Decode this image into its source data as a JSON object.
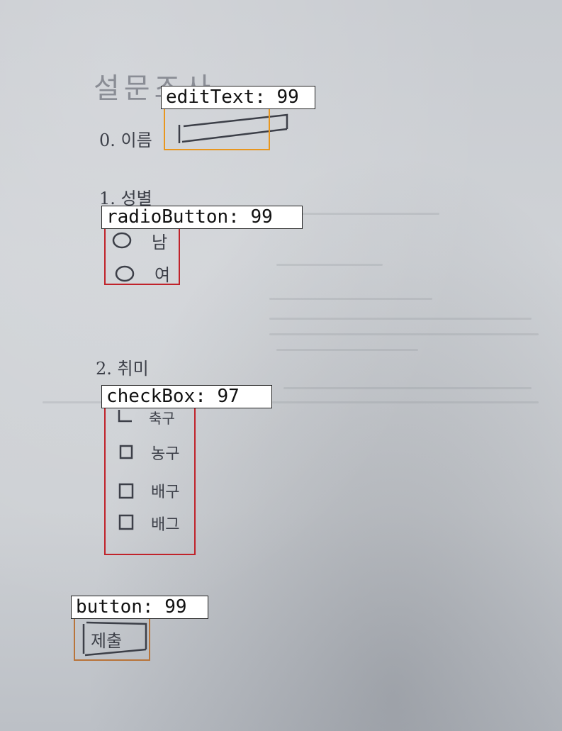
{
  "form": {
    "title": "설문조사",
    "name_label": "0. 이름",
    "gender_label": "1. 성별",
    "gender_options": [
      "남",
      "여"
    ],
    "hobby_label": "2. 취미",
    "hobby_options": [
      "축구",
      "농구",
      "배구",
      "배그"
    ],
    "submit_label": "제출"
  },
  "detections": [
    {
      "class": "editText",
      "score": 99,
      "text": "editText: 99",
      "color": "#e8961e"
    },
    {
      "class": "radioButton",
      "score": 99,
      "text": "radioButton: 99",
      "color": "#c0222a"
    },
    {
      "class": "checkBox",
      "score": 97,
      "text": "checkBox: 97",
      "color": "#c0222a"
    },
    {
      "class": "button",
      "score": 99,
      "text": "button: 99",
      "color": "#b8743a"
    }
  ]
}
